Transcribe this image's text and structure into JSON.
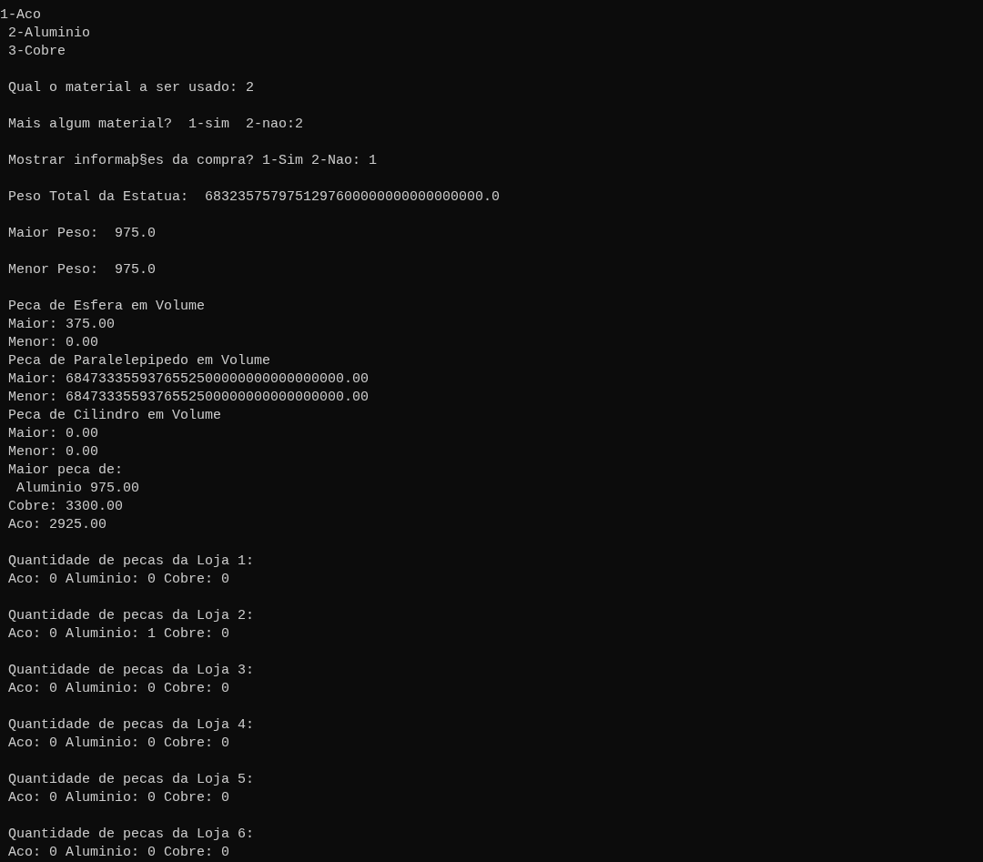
{
  "console": {
    "blocks": [
      {
        "lines": [
          "1-Aco",
          " 2-Aluminio",
          " 3-Cobre"
        ]
      },
      {
        "lines": [
          " Qual o material a ser usado: 2"
        ]
      },
      {
        "lines": [
          " Mais algum material?  1-sim  2-nao:2"
        ]
      },
      {
        "lines": [
          " Mostrar informaþ§es da compra? 1-Sim 2-Nao: 1"
        ]
      },
      {
        "lines": [
          " Peso Total da Estatua:  6832357579751297600000000000000000.0"
        ]
      },
      {
        "lines": [
          " Maior Peso:  975.0"
        ]
      },
      {
        "lines": [
          " Menor Peso:  975.0"
        ]
      },
      {
        "lines": [
          " Peca de Esfera em Volume",
          " Maior: 375.00",
          " Menor: 0.00",
          " Peca de Paralelepipedo em Volume",
          " Maior: 6847333559376552500000000000000000.00",
          " Menor: 6847333559376552500000000000000000.00",
          " Peca de Cilindro em Volume",
          " Maior: 0.00",
          " Menor: 0.00",
          " Maior peca de:",
          "  Aluminio 975.00",
          " Cobre: 3300.00",
          " Aco: 2925.00"
        ]
      },
      {
        "lines": [
          " Quantidade de pecas da Loja 1:",
          " Aco: 0 Aluminio: 0 Cobre: 0"
        ]
      },
      {
        "lines": [
          " Quantidade de pecas da Loja 2:",
          " Aco: 0 Aluminio: 1 Cobre: 0"
        ]
      },
      {
        "lines": [
          " Quantidade de pecas da Loja 3:",
          " Aco: 0 Aluminio: 0 Cobre: 0"
        ]
      },
      {
        "lines": [
          " Quantidade de pecas da Loja 4:",
          " Aco: 0 Aluminio: 0 Cobre: 0"
        ]
      },
      {
        "lines": [
          " Quantidade de pecas da Loja 5:",
          " Aco: 0 Aluminio: 0 Cobre: 0"
        ]
      },
      {
        "lines": [
          " Quantidade de pecas da Loja 6:",
          " Aco: 0 Aluminio: 0 Cobre: 0"
        ]
      }
    ]
  }
}
